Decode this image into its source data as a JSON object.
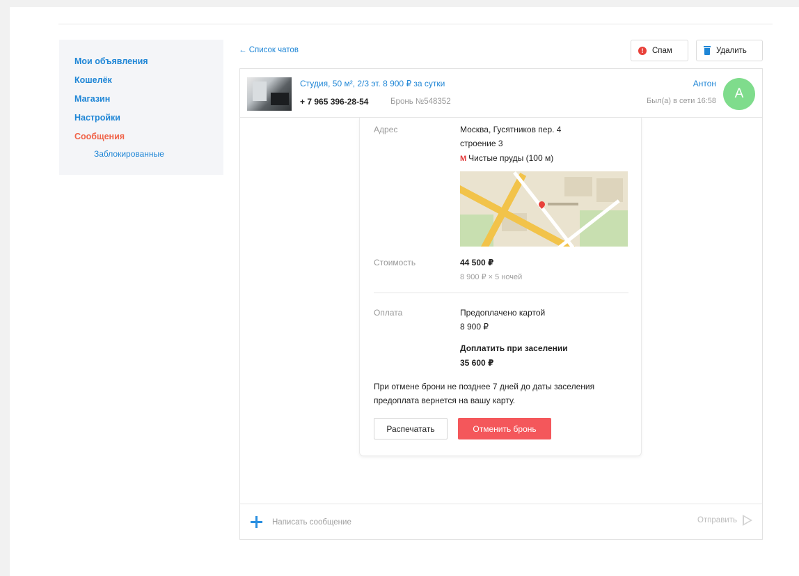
{
  "sidebar": {
    "items": [
      {
        "label": "Мои объявления",
        "active": false
      },
      {
        "label": "Кошелёк",
        "active": false
      },
      {
        "label": "Магазин",
        "active": false
      },
      {
        "label": "Настройки",
        "active": false
      },
      {
        "label": "Сообщения",
        "active": true
      }
    ],
    "sub_item": "Заблокированные"
  },
  "toolbar": {
    "back_label": "← Список чатов",
    "spam_label": "Спам",
    "delete_label": "Удалить"
  },
  "chat_header": {
    "listing_title": "Студия, 50 м², 2/3 эт. 8 900 ₽ за сутки",
    "phone": "+ 7 965 396-28-54",
    "booking_number": "Бронь №548352",
    "user_name": "Антон",
    "last_seen": "Был(а) в сети 16:58",
    "avatar_letter": "А"
  },
  "booking": {
    "address_label": "Адрес",
    "address_line1": "Москва, Гусятников пер. 4",
    "address_line2": "строение 3",
    "metro_icon": "М",
    "metro": "Чистые пруды (100 м)",
    "cost_label": "Стоимость",
    "cost_total": "44 500 ₽",
    "cost_detail": "8 900 ₽ × 5 ночей",
    "payment_label": "Оплата",
    "prepaid_label": "Предоплачено картой",
    "prepaid_amount": "8 900 ₽",
    "due_label": "Доплатить при заселении",
    "due_amount": "35 600 ₽",
    "cancel_note": "При отмене брони не позднее 7 дней до даты заселения предоплата вернется на вашу карту.",
    "print_label": "Распечатать",
    "cancel_label": "Отменить бронь"
  },
  "composer": {
    "placeholder": "Написать сообщение",
    "send_label": "Отправить"
  },
  "colors": {
    "link": "#1f86d6",
    "active": "#f0644a",
    "danger": "#f4575b",
    "avatar": "#7fdc8c"
  }
}
